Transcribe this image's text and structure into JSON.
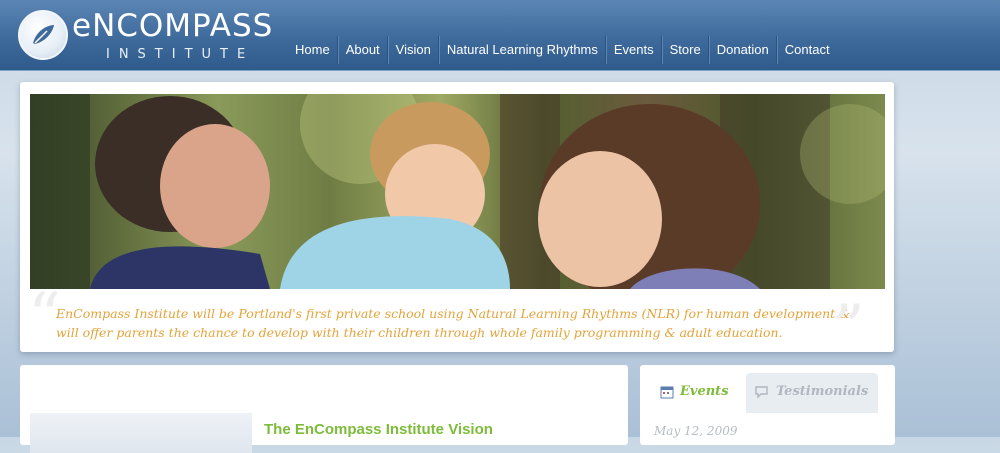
{
  "brand": {
    "name": "eNCOMPASS",
    "sub": "INSTITUTE"
  },
  "nav": {
    "items": [
      {
        "label": "Home"
      },
      {
        "label": "About"
      },
      {
        "label": "Vision"
      },
      {
        "label": "Natural Learning Rhythms"
      },
      {
        "label": "Events"
      },
      {
        "label": "Store"
      },
      {
        "label": "Donation"
      },
      {
        "label": "Contact"
      }
    ]
  },
  "hero": {
    "quote": "EnCompass Institute will be Portland's first private school using Natural Learning Rhythms (NLR) for human development & will offer parents the chance to develop with their children through whole family programming & adult education."
  },
  "main": {
    "section_title": "The EnCompass Institute Vision"
  },
  "sidebar": {
    "tabs": [
      {
        "label": "Events",
        "icon": "calendar-icon"
      },
      {
        "label": "Testimonials",
        "icon": "speech-bubble-icon"
      }
    ],
    "first_date": "May 12, 2009"
  },
  "colors": {
    "accent_green": "#7dbb3a",
    "quote_orange": "#e3a33a",
    "header_blue": "#3e6a9c"
  }
}
